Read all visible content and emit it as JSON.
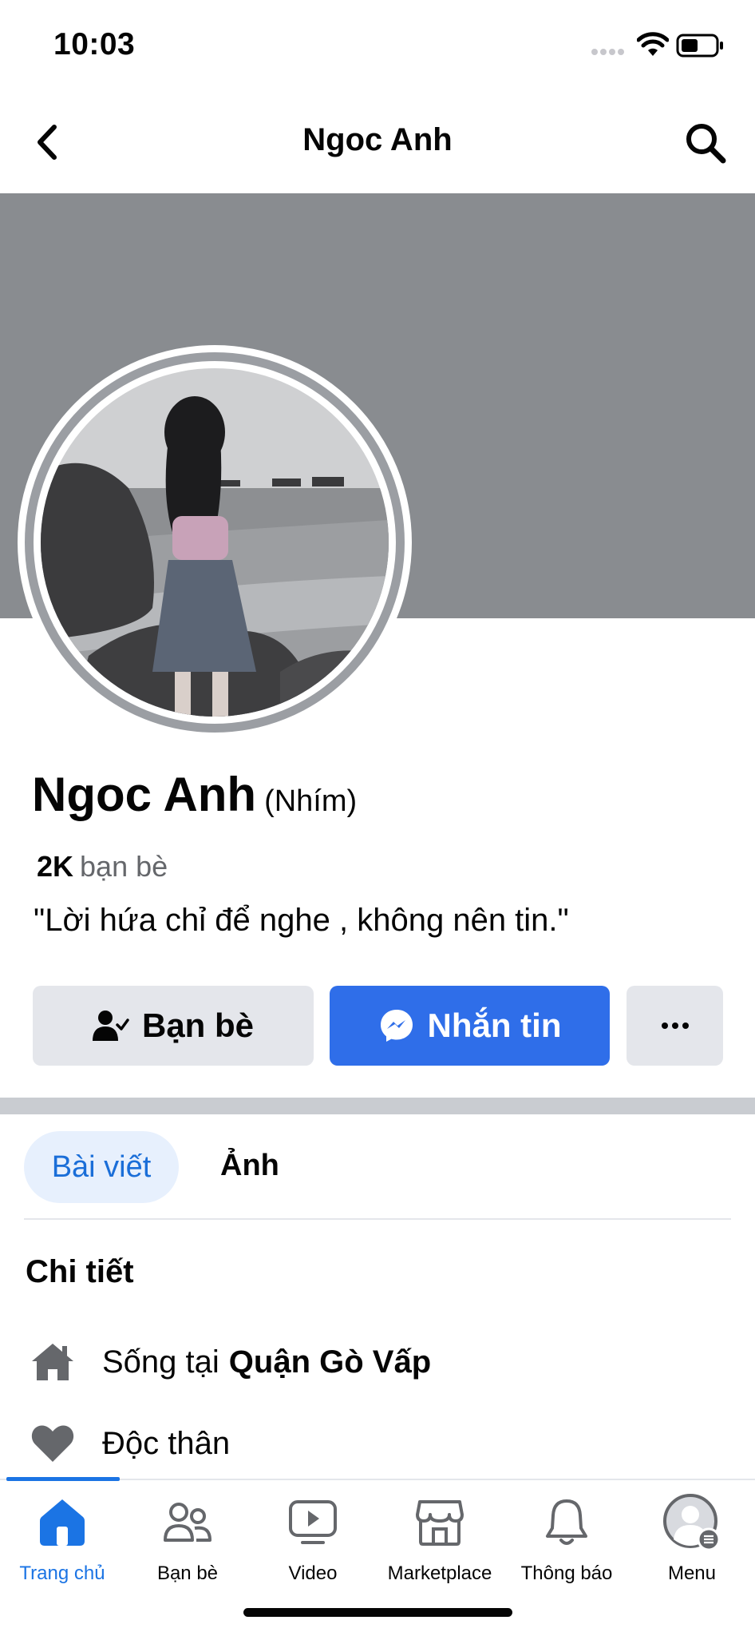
{
  "status_bar": {
    "time": "10:03"
  },
  "header": {
    "title": "Ngoc Anh"
  },
  "profile": {
    "name": "Ngoc Anh",
    "nickname": "(Nhím)",
    "friends_count": "2K",
    "friends_label": "bạn bè",
    "bio": "\"Lời hứa chỉ để nghe , không nên tin.\""
  },
  "actions": {
    "friends_label": "Bạn bè",
    "message_label": "Nhắn tin"
  },
  "tabs": [
    {
      "label": "Bài viết",
      "active": true
    },
    {
      "label": "Ảnh",
      "active": false
    }
  ],
  "details": {
    "title": "Chi tiết",
    "lives_prefix": "Sống tại",
    "lives_place": "Quận Gò Vấp",
    "relationship": "Độc thân"
  },
  "bottom_nav": [
    {
      "label": "Trang chủ",
      "icon": "home-icon",
      "active": true
    },
    {
      "label": "Bạn bè",
      "icon": "friends-icon",
      "active": false
    },
    {
      "label": "Video",
      "icon": "video-icon",
      "active": false
    },
    {
      "label": "Marketplace",
      "icon": "marketplace-icon",
      "active": false
    },
    {
      "label": "Thông báo",
      "icon": "bell-icon",
      "active": false
    },
    {
      "label": "Menu",
      "icon": "menu-avatar-icon",
      "active": false
    }
  ],
  "colors": {
    "accent": "#1b74e4",
    "cover": "#898c90",
    "message_button": "#2f6ee9"
  }
}
